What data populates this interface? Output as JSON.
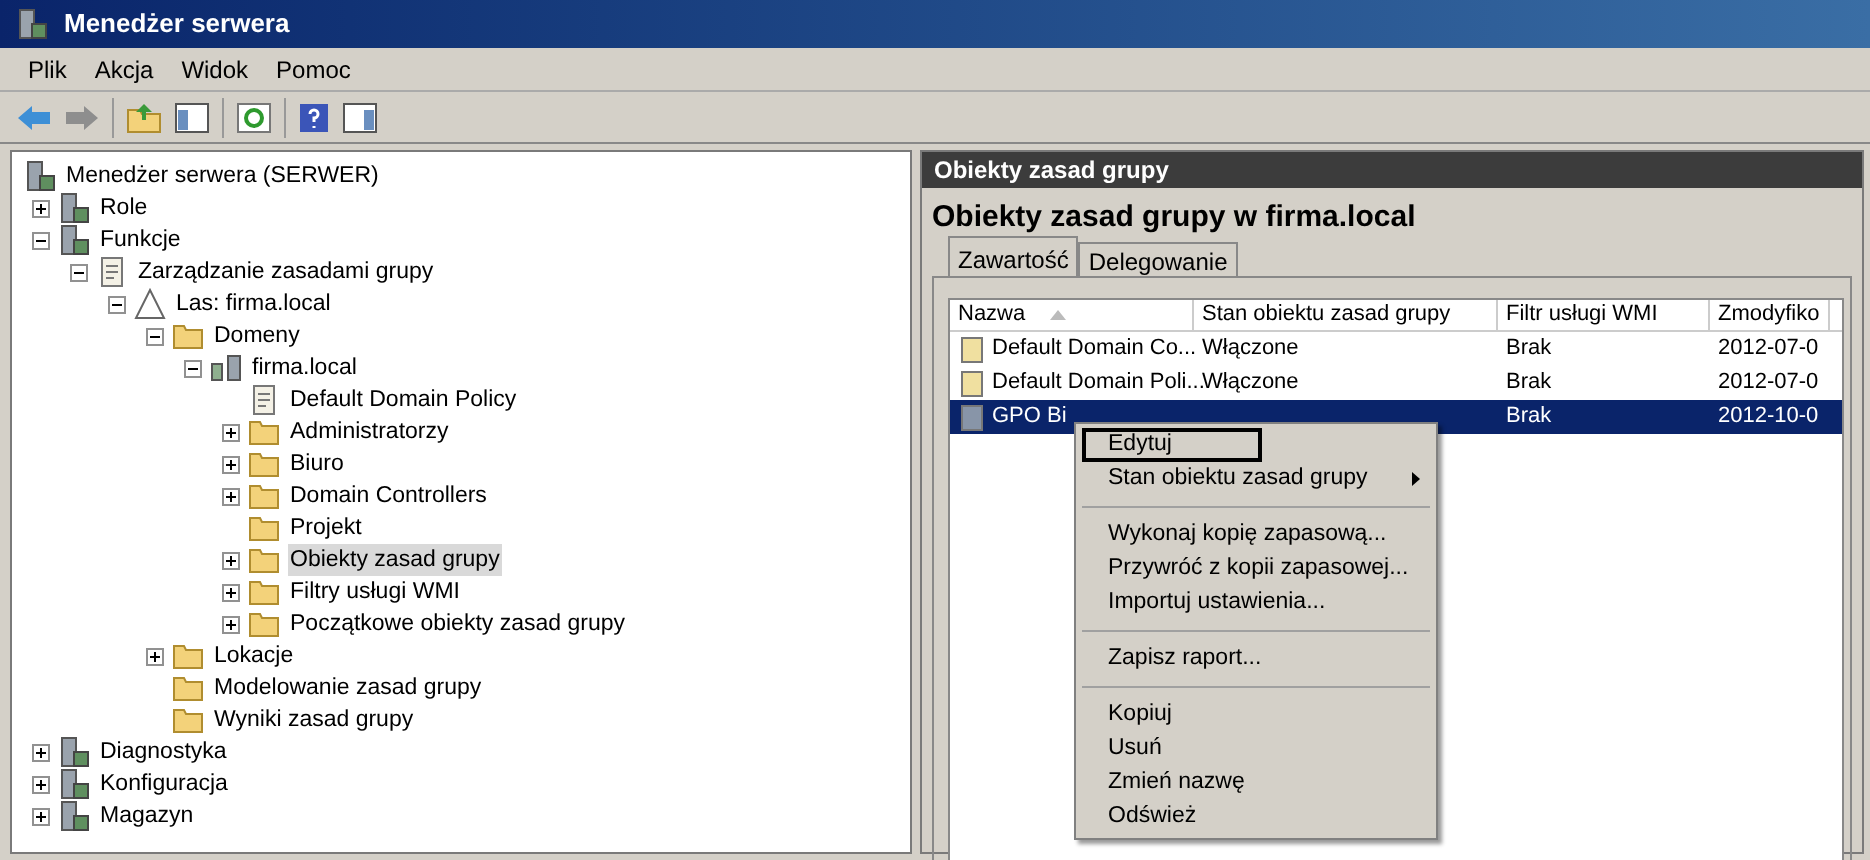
{
  "window": {
    "title": "Menedżer serwera"
  },
  "menu": [
    "Plik",
    "Akcja",
    "Widok",
    "Pomoc"
  ],
  "tree": [
    {
      "label": "Menedżer serwera (SERWER)",
      "kind": "server",
      "selected": false,
      "children": [
        {
          "label": "Role",
          "kind": "server",
          "expanded": false,
          "selected": false
        },
        {
          "label": "Funkcje",
          "kind": "server",
          "expanded": true,
          "selected": false,
          "children": [
            {
              "label": "Zarządzanie zasadami grupy",
              "kind": "doc",
              "expanded": true,
              "selected": false,
              "children": [
                {
                  "label": "Las: firma.local",
                  "kind": "forest",
                  "expanded": true,
                  "selected": false,
                  "children": [
                    {
                      "label": "Domeny",
                      "kind": "folder",
                      "expanded": true,
                      "selected": false,
                      "children": [
                        {
                          "label": "firma.local",
                          "kind": "domain",
                          "expanded": true,
                          "selected": false,
                          "children": [
                            {
                              "label": "Default Domain Policy",
                              "kind": "doc",
                              "selected": false
                            },
                            {
                              "label": "Administratorzy",
                              "kind": "folder",
                              "expanded": false,
                              "selected": false
                            },
                            {
                              "label": "Biuro",
                              "kind": "folder",
                              "expanded": false,
                              "selected": false
                            },
                            {
                              "label": "Domain Controllers",
                              "kind": "folder",
                              "expanded": false,
                              "selected": false
                            },
                            {
                              "label": "Projekt",
                              "kind": "folder",
                              "selected": false
                            },
                            {
                              "label": "Obiekty zasad grupy",
                              "kind": "folder",
                              "expanded": false,
                              "selected": true
                            },
                            {
                              "label": "Filtry usługi WMI",
                              "kind": "folder",
                              "expanded": false,
                              "selected": false
                            },
                            {
                              "label": "Początkowe obiekty zasad grupy",
                              "kind": "folder",
                              "expanded": false,
                              "selected": false
                            }
                          ]
                        }
                      ]
                    },
                    {
                      "label": "Lokacje",
                      "kind": "folder",
                      "expanded": false,
                      "selected": false
                    },
                    {
                      "label": "Modelowanie zasad grupy",
                      "kind": "folder",
                      "selected": false
                    },
                    {
                      "label": "Wyniki zasad grupy",
                      "kind": "folder",
                      "selected": false
                    }
                  ]
                }
              ]
            }
          ]
        },
        {
          "label": "Diagnostyka",
          "kind": "server",
          "expanded": false,
          "selected": false
        },
        {
          "label": "Konfiguracja",
          "kind": "server",
          "expanded": false,
          "selected": false
        },
        {
          "label": "Magazyn",
          "kind": "server",
          "expanded": false,
          "selected": false
        }
      ]
    }
  ],
  "right_panel": {
    "header": "Obiekty zasad grupy",
    "title": "Obiekty zasad grupy w firma.local",
    "tabs": [
      {
        "label": "Zawartość",
        "selected": true
      },
      {
        "label": "Delegowanie",
        "selected": false
      }
    ],
    "table": {
      "columns": [
        "Nazwa",
        "Stan obiektu zasad grupy",
        "Filtr usługi WMI",
        "Zmodyfiko"
      ],
      "rows": [
        {
          "cells": [
            "Default Domain Co...",
            "Włączone",
            "Brak",
            "2012-07-0"
          ],
          "selected": false
        },
        {
          "cells": [
            "Default Domain Poli...",
            "Włączone",
            "Brak",
            "2012-07-0"
          ],
          "selected": false
        },
        {
          "cells": [
            "GPO Bi",
            "",
            "Brak",
            "2012-10-0"
          ],
          "selected": true
        }
      ]
    }
  },
  "context_menu": [
    {
      "kind": "item",
      "label": "Edytuj",
      "focused": true
    },
    {
      "kind": "submenu",
      "label": "Stan obiektu zasad grupy",
      "focused": false
    },
    {
      "kind": "separator"
    },
    {
      "kind": "item",
      "label": "Wykonaj kopię zapasową...",
      "focused": false
    },
    {
      "kind": "item",
      "label": "Przywróć z kopii zapasowej...",
      "focused": false
    },
    {
      "kind": "item",
      "label": "Importuj ustawienia...",
      "focused": false
    },
    {
      "kind": "separator"
    },
    {
      "kind": "item",
      "label": "Zapisz raport...",
      "focused": false
    },
    {
      "kind": "separator"
    },
    {
      "kind": "item",
      "label": "Kopiuj",
      "focused": false
    },
    {
      "kind": "item",
      "label": "Usuń",
      "focused": false
    },
    {
      "kind": "item",
      "label": "Zmień nazwę",
      "focused": false
    },
    {
      "kind": "item",
      "label": "Odśwież",
      "focused": false
    }
  ]
}
